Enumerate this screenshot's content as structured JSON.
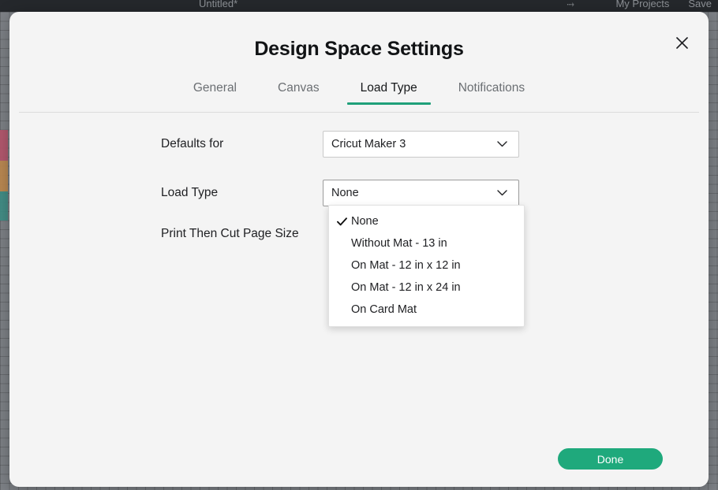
{
  "background": {
    "document_title": "Untitled*",
    "header_icon": "arrows-icon",
    "my_projects_label": "My Projects",
    "save_label": "Save"
  },
  "modal": {
    "title": "Design Space Settings",
    "close_icon": "close-icon",
    "tabs": [
      {
        "label": "General",
        "active": false
      },
      {
        "label": "Canvas",
        "active": false
      },
      {
        "label": "Load Type",
        "active": true
      },
      {
        "label": "Notifications",
        "active": false
      }
    ],
    "rows": {
      "defaults": {
        "label": "Defaults for",
        "value": "Cricut Maker 3",
        "chevron_icon": "chevron-down-icon"
      },
      "load_type": {
        "label": "Load Type",
        "value": "None",
        "chevron_icon": "chevron-down-icon"
      },
      "page_size": {
        "label": "Print Then Cut Page Size"
      }
    },
    "dropdown": {
      "open": true,
      "check_icon": "check-icon",
      "items": [
        {
          "label": "None",
          "selected": true
        },
        {
          "label": "Without Mat - 13 in",
          "selected": false
        },
        {
          "label": "On Mat - 12 in x 12 in",
          "selected": false
        },
        {
          "label": "On Mat - 12 in x 24 in",
          "selected": false
        },
        {
          "label": "On Card Mat",
          "selected": false
        }
      ]
    },
    "done_label": "Done",
    "accent_color": "#1fa97c",
    "tab_indicator_color": "#1fa07a"
  }
}
